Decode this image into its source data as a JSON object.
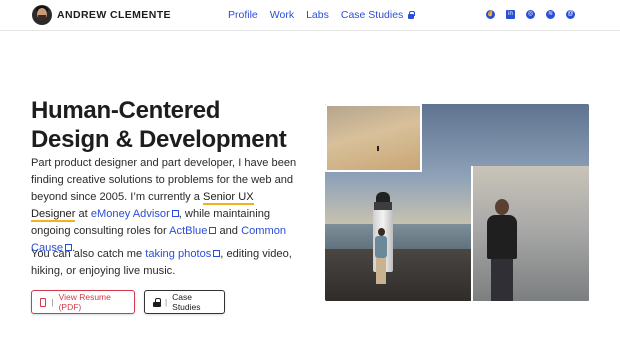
{
  "header": {
    "brand": "ANDREW CLEMENTE",
    "nav": [
      {
        "label": "Profile"
      },
      {
        "label": "Work"
      },
      {
        "label": "Labs"
      },
      {
        "label": "Case Studies"
      }
    ],
    "social_icons": [
      "peace-icon",
      "linkedin-icon",
      "dribbble-icon",
      "spotify-icon",
      "at-sign-icon"
    ]
  },
  "hero": {
    "title_line1": "Human-Centered",
    "title_line2": "Design & Development",
    "para1_a": "Part product designer and part developer, I have been finding creative solutions to problems for the web and beyond since 2005. I’m currently a ",
    "para1_role": "Senior UX Designer",
    "para1_b": " at ",
    "para1_company": "eMoney Advisor",
    "para1_c": ", while maintaining ongoing consulting roles for ",
    "para1_client1": "ActBlue",
    "para1_d": " and ",
    "para1_client2": "Common Cause",
    "para1_e": ".",
    "para2_a": "You can also catch me ",
    "para2_link": "taking photos",
    "para2_b": ", editing video, hiking, or enjoying live music."
  },
  "buttons": {
    "separator": "|",
    "resume": "View Resume (PDF)",
    "case_studies": "Case Studies"
  },
  "colors": {
    "link": "#2b4ed6",
    "highlight": "#f2b21b",
    "resume_accent": "#d33b4a"
  }
}
